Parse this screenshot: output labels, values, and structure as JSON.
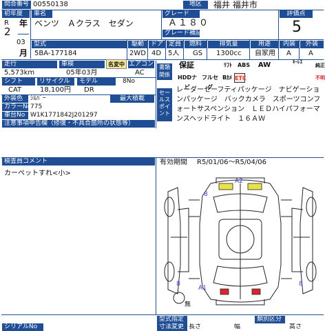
{
  "header": {
    "lot_label": "問合番号",
    "lot_value": "00550138",
    "region_label": "地区",
    "region_value": "福井 福井市",
    "first_reg_label": "初年度",
    "era": "R",
    "year_num": "2",
    "year_unit": "年",
    "month_num": "03",
    "month_unit": "月",
    "car_name_label": "車名",
    "car_name_value": "ベンツ　Ａクラス　セダン",
    "grade_label": "グレード",
    "grade_value": "Ａ１８０",
    "grade_supplement_label": "グレード補記",
    "score_label": "評価点",
    "score_value": "5"
  },
  "spec": {
    "model_label": "型式",
    "drive_label": "駆動",
    "doors_label": "ドア",
    "capacity_label": "定員",
    "fuel_label": "燃料",
    "displacement_label": "排気量",
    "usage_label": "用途",
    "interior_label": "内装",
    "exterior_label": "外装",
    "model_value": "5BA-177184",
    "drive_value": "2WD",
    "doors_value": "4D",
    "capacity_value": "5人",
    "fuel_value": "GS",
    "displacement_value": "1300cc",
    "usage_value": "自家用",
    "interior_value": "A",
    "exterior_value": "A"
  },
  "details": {
    "mileage_label": "走行",
    "inspection_label": "車検",
    "name_change_badge": "名変中",
    "ac_label": "エアコン",
    "mileage_value": "5,573km",
    "inspection_value": "05年03月",
    "ac_value": "AC",
    "shift_label": "シフト",
    "price_label": "リサイクル",
    "model_year_label": "モデル",
    "model_year_value": "8No",
    "shift_value": "CAT",
    "price_value": "18,100円",
    "model_value": "DR",
    "color_label": "外装色",
    "color_value": "ｼﾙﾊﾞｰ",
    "max_load_label": "最大積載",
    "color_no_label": "カラーNo",
    "color_no_value": "775",
    "vin_label": "車台No",
    "vin_value": "W1K1771842J201297",
    "notice": "注意事項申告欄（修復・不具合箇所の状態等）"
  },
  "docs": {
    "docs_label": "書類関係",
    "tags": [
      "保証",
      "ﾘﾌﾄ",
      "ｷｰﾚｽ",
      "ABS",
      "AW",
      "純正",
      "HDDナビ",
      "フルセグ",
      "Bｶﾒ",
      "ETC",
      "不明"
    ]
  },
  "sales_point": {
    "label": "セールスポイント",
    "text": "レーダーセーフティパッケージ　ナビゲーションパッケージ　バックカメラ　スポーツコンフォートサスペンション　ＬＥＤハイパフォーマンスヘッドライト　１６ＡＷ"
  },
  "inspection": {
    "comment_label": "検査員コメント",
    "comment_text": "カーペットすれ<小>",
    "period_label": "有効期間",
    "period_value": "R5/01/06～R5/04/06",
    "markers": {
      "a2": "A2",
      "a1": "A1",
      "eight_top": "8",
      "eight_left": "8",
      "eight_right": "8",
      "none": "無"
    }
  },
  "footer": {
    "model_designation_label": "型式指定",
    "category_label": "類別区分",
    "dims_label": "寸法変更",
    "length_label": "長さ",
    "width_label": "幅",
    "height_label": "高さ",
    "serial_label": "シリアルNo"
  },
  "colors": {
    "label_bg": "#1f4e95",
    "damage_yellow": "#e8e34a",
    "damage_red": "#d9252b",
    "diagram_stroke": "#222222",
    "etc_red": "#e23a2e"
  }
}
